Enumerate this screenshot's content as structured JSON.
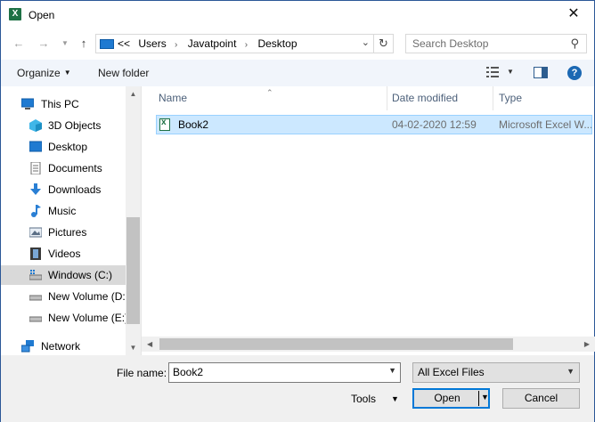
{
  "window": {
    "title": "Open",
    "app_icon": "excel-icon",
    "close_glyph": "✕"
  },
  "address_bar": {
    "overflow": "<<",
    "path": [
      "Users",
      "Javatpoint",
      "Desktop"
    ],
    "separator": "›",
    "refresh_glyph": "↻",
    "drop_glyph": "⌄"
  },
  "search": {
    "placeholder": "Search Desktop"
  },
  "commands": {
    "organize": "Organize",
    "new_folder": "New folder"
  },
  "nav": {
    "items": [
      {
        "label": "This PC",
        "icon": "this-pc-icon",
        "level": 0
      },
      {
        "label": "3D Objects",
        "icon": "3d-objects-icon",
        "level": 1
      },
      {
        "label": "Desktop",
        "icon": "desktop-icon",
        "level": 1
      },
      {
        "label": "Documents",
        "icon": "documents-icon",
        "level": 1
      },
      {
        "label": "Downloads",
        "icon": "downloads-icon",
        "level": 1
      },
      {
        "label": "Music",
        "icon": "music-icon",
        "level": 1
      },
      {
        "label": "Pictures",
        "icon": "pictures-icon",
        "level": 1
      },
      {
        "label": "Videos",
        "icon": "videos-icon",
        "level": 1
      },
      {
        "label": "Windows (C:)",
        "icon": "drive-c-icon",
        "level": 1,
        "selected": true
      },
      {
        "label": "New Volume (D:",
        "icon": "drive-icon",
        "level": 1
      },
      {
        "label": "New Volume (E:)",
        "icon": "drive-icon",
        "level": 1
      },
      {
        "label": "Network",
        "icon": "network-icon",
        "level": 0
      }
    ]
  },
  "file_list": {
    "columns": {
      "name": "Name",
      "date": "Date modified",
      "type": "Type"
    },
    "rows": [
      {
        "name": "Book2",
        "date": "04-02-2020 12:59",
        "type": "Microsoft Excel W...",
        "selected": true
      }
    ]
  },
  "footer": {
    "file_name_label": "File name:",
    "file_name_value": "Book2",
    "file_type_value": "All Excel Files",
    "tools_label": "Tools",
    "open_label": "Open",
    "cancel_label": "Cancel"
  },
  "colors": {
    "accent": "#0078d7",
    "selection": "#cce8ff",
    "excel_green": "#1e7145",
    "command_bar": "#f1f5fb"
  }
}
